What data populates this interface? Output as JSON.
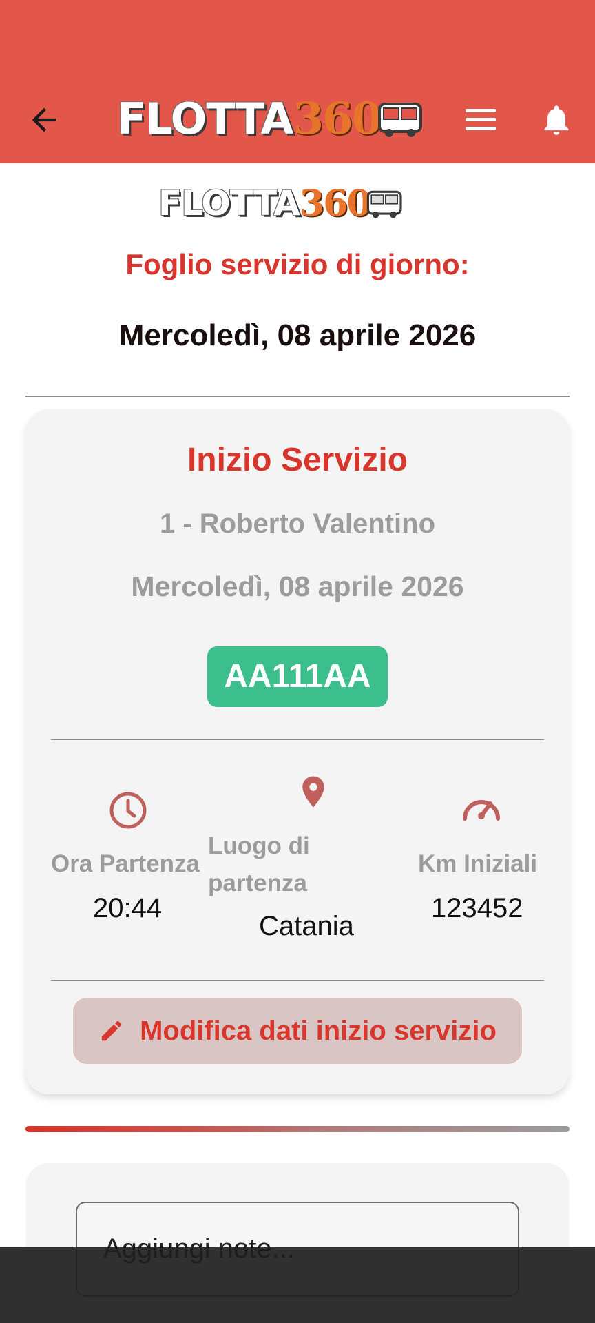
{
  "appbar": {
    "back_icon": "arrow-back-icon",
    "logo_text": "FLOTTA",
    "logo_number": "360",
    "menu_icon": "hamburger-menu-icon",
    "bell_icon": "notification-bell-icon",
    "background_color": "#e3564a"
  },
  "header": {
    "logo_text": "FLOTTA",
    "logo_number": "360",
    "title": "Foglio servizio di giorno:",
    "date": "Mercoledì, 08 aprile 2026"
  },
  "service_card": {
    "title": "Inizio Servizio",
    "driver": "1 - Roberto Valentino",
    "date": "Mercoledì, 08 aprile 2026",
    "plate": "AA111AA",
    "stats": {
      "departure_time": {
        "label": "Ora Partenza",
        "value": "20:44",
        "icon": "clock-icon"
      },
      "departure_place": {
        "label_line1": "Luogo di",
        "label_line2": "partenza",
        "value": "Catania",
        "icon": "location-pin-icon"
      },
      "initial_km": {
        "label": "Km Iniziali",
        "value": "123452",
        "icon": "speedometer-icon"
      }
    },
    "edit_button": {
      "label": "Modifica dati inizio servizio",
      "icon": "pencil-icon"
    }
  },
  "notes": {
    "placeholder": "Aggiungi note..."
  },
  "colors": {
    "accent_red": "#d8362c",
    "plate_green": "#3cbf8c",
    "muted_text": "#9c9c9c"
  }
}
